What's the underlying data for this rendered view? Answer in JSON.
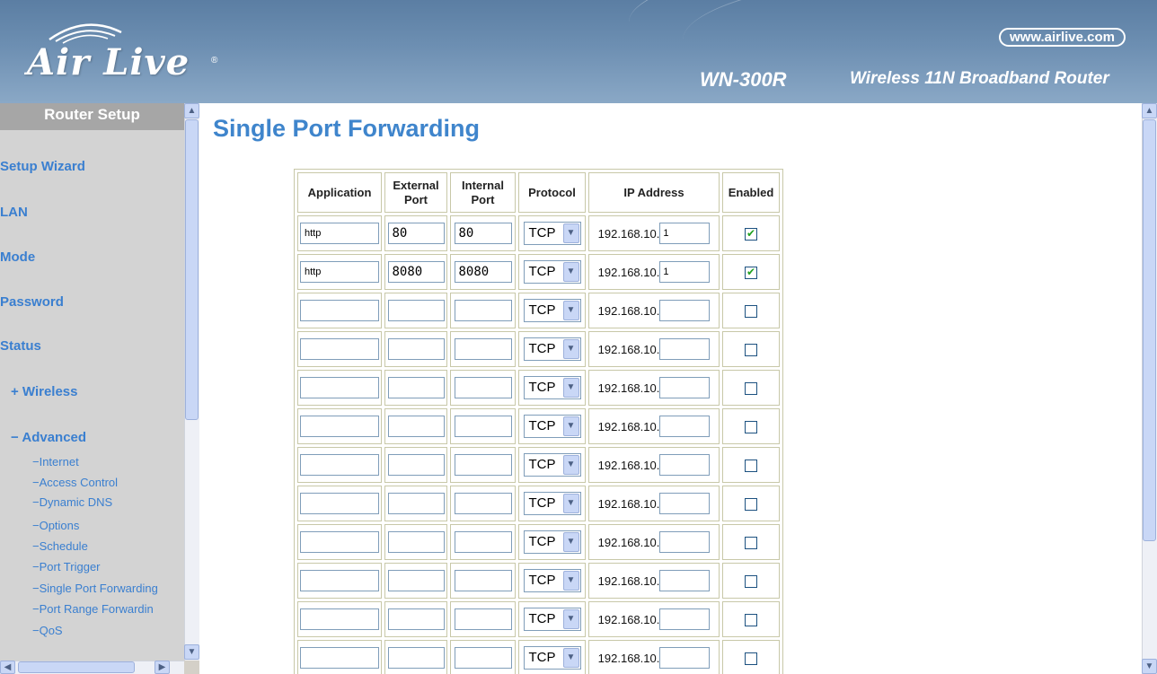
{
  "header": {
    "logo_text": "Air Live",
    "logo_reg": "®",
    "url": "www.airlive.com",
    "model": "WN-300R",
    "tagline": "Wireless 11N Broadband Router"
  },
  "sidebar": {
    "title": "Router Setup",
    "items": [
      {
        "label": "Setup Wizard"
      },
      {
        "label": "LAN"
      },
      {
        "label": "Mode"
      },
      {
        "label": "Password"
      },
      {
        "label": "Status"
      },
      {
        "label": "+ Wireless"
      },
      {
        "label": "− Advanced"
      }
    ],
    "subitems": [
      {
        "label": "−Internet"
      },
      {
        "label": "−Access Control"
      },
      {
        "label": "−Dynamic DNS"
      },
      {
        "label": "−Options"
      },
      {
        "label": "−Schedule"
      },
      {
        "label": "−Port Trigger"
      },
      {
        "label": "−Single Port Forwarding"
      },
      {
        "label": "−Port Range Forwardin"
      },
      {
        "label": "−QoS"
      }
    ]
  },
  "main": {
    "title": "Single Port Forwarding",
    "columns": [
      "Application",
      "External Port",
      "Internal Port",
      "Protocol",
      "IP Address",
      "Enabled"
    ],
    "ip_prefix": "192.168.10.",
    "rows": [
      {
        "application": "http",
        "external": "80",
        "internal": "80",
        "protocol": "TCP",
        "ip_last": "1",
        "enabled": true
      },
      {
        "application": "http",
        "external": "8080",
        "internal": "8080",
        "protocol": "TCP",
        "ip_last": "1",
        "enabled": true
      },
      {
        "application": "",
        "external": "",
        "internal": "",
        "protocol": "TCP",
        "ip_last": "",
        "enabled": false
      },
      {
        "application": "",
        "external": "",
        "internal": "",
        "protocol": "TCP",
        "ip_last": "",
        "enabled": false
      },
      {
        "application": "",
        "external": "",
        "internal": "",
        "protocol": "TCP",
        "ip_last": "",
        "enabled": false
      },
      {
        "application": "",
        "external": "",
        "internal": "",
        "protocol": "TCP",
        "ip_last": "",
        "enabled": false
      },
      {
        "application": "",
        "external": "",
        "internal": "",
        "protocol": "TCP",
        "ip_last": "",
        "enabled": false
      },
      {
        "application": "",
        "external": "",
        "internal": "",
        "protocol": "TCP",
        "ip_last": "",
        "enabled": false
      },
      {
        "application": "",
        "external": "",
        "internal": "",
        "protocol": "TCP",
        "ip_last": "",
        "enabled": false
      },
      {
        "application": "",
        "external": "",
        "internal": "",
        "protocol": "TCP",
        "ip_last": "",
        "enabled": false
      },
      {
        "application": "",
        "external": "",
        "internal": "",
        "protocol": "TCP",
        "ip_last": "",
        "enabled": false
      },
      {
        "application": "",
        "external": "",
        "internal": "",
        "protocol": "TCP",
        "ip_last": "",
        "enabled": false
      }
    ]
  },
  "icons": {
    "scroll_up": "scroll-up-arrow-icon",
    "scroll_down": "scroll-down-arrow-icon",
    "scroll_left": "scroll-left-arrow-icon",
    "scroll_right": "scroll-right-arrow-icon",
    "dropdown": "chevron-down-icon",
    "checkbox": "checkbox-check-icon"
  },
  "colors": {
    "banner": "#6d8fb2",
    "link": "#3a7fd0",
    "title": "#3f85cc",
    "sidebar_bg": "#d3d3d3",
    "sidebar_header": "#a6a6a6"
  }
}
